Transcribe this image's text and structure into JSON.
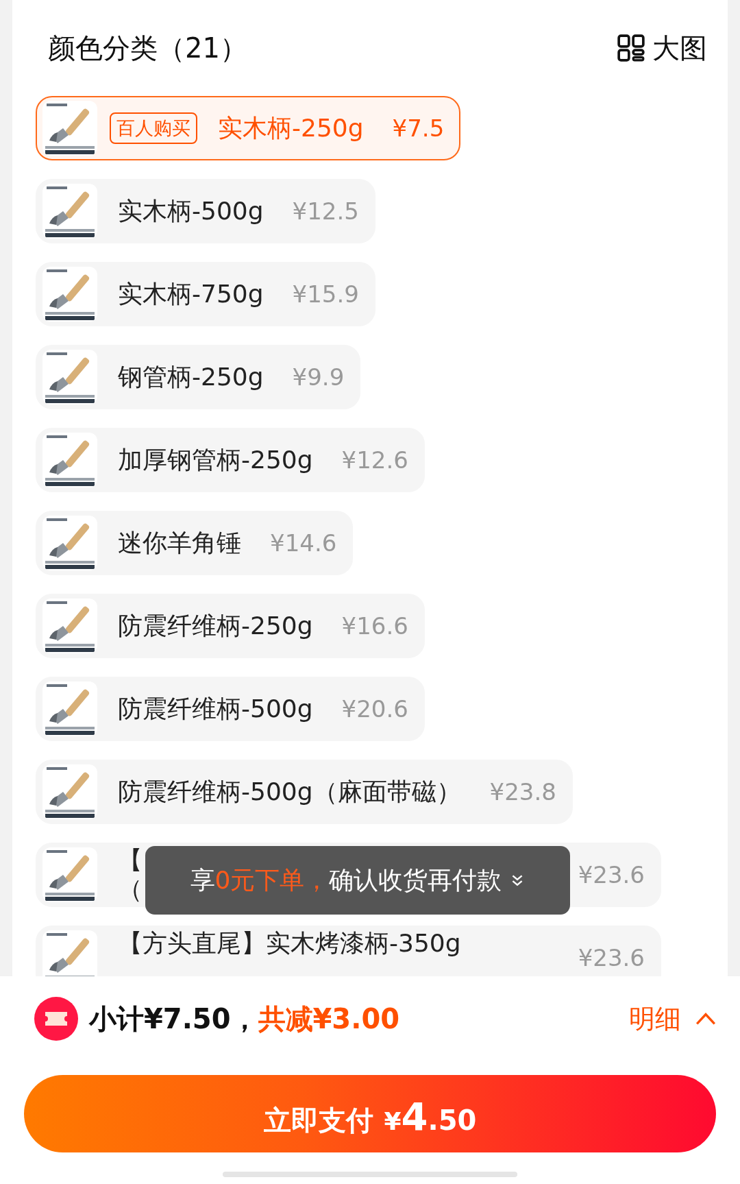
{
  "header": {
    "title": "颜色分类（21）",
    "view_toggle": "大图"
  },
  "items": [
    {
      "name": "实木柄-250g",
      "price": "¥7.5",
      "badge": "百人购买",
      "selected": true
    },
    {
      "name": "实木柄-500g",
      "price": "¥12.5",
      "selected": false
    },
    {
      "name": "实木柄-750g",
      "price": "¥15.9",
      "selected": false
    },
    {
      "name": "钢管柄-250g",
      "price": "¥9.9",
      "selected": false
    },
    {
      "name": "加厚钢管柄-250g",
      "price": "¥12.6",
      "selected": false
    },
    {
      "name": "迷你羊角锤",
      "price": "¥14.6",
      "selected": false
    },
    {
      "name": "防震纤维柄-250g",
      "price": "¥16.6",
      "selected": false
    },
    {
      "name": "防震纤维柄-500g",
      "price": "¥20.6",
      "selected": false
    },
    {
      "name": "防震纤维柄-500g（麻面带磁）",
      "price": "¥23.8",
      "selected": false
    },
    {
      "name_lines": [
        "【",
        "（"
      ],
      "price": "¥23.6",
      "selected": false
    },
    {
      "name_lines": [
        "【方头直尾】实木烤漆柄-350g"
      ],
      "price": "¥23.6",
      "selected": false
    }
  ],
  "toast": {
    "parts": [
      {
        "text": "享",
        "highlight": false
      },
      {
        "text": "0元下单，",
        "highlight": true
      },
      {
        "text": "确认收货再付款",
        "highlight": false
      }
    ]
  },
  "summary": {
    "subtotal": "小计¥7.50，",
    "discount": "共减¥3.00",
    "details_link": "明细"
  },
  "pay_button": {
    "label": "立即支付",
    "currency": "¥",
    "integer": "4",
    "decimal": ".50"
  }
}
